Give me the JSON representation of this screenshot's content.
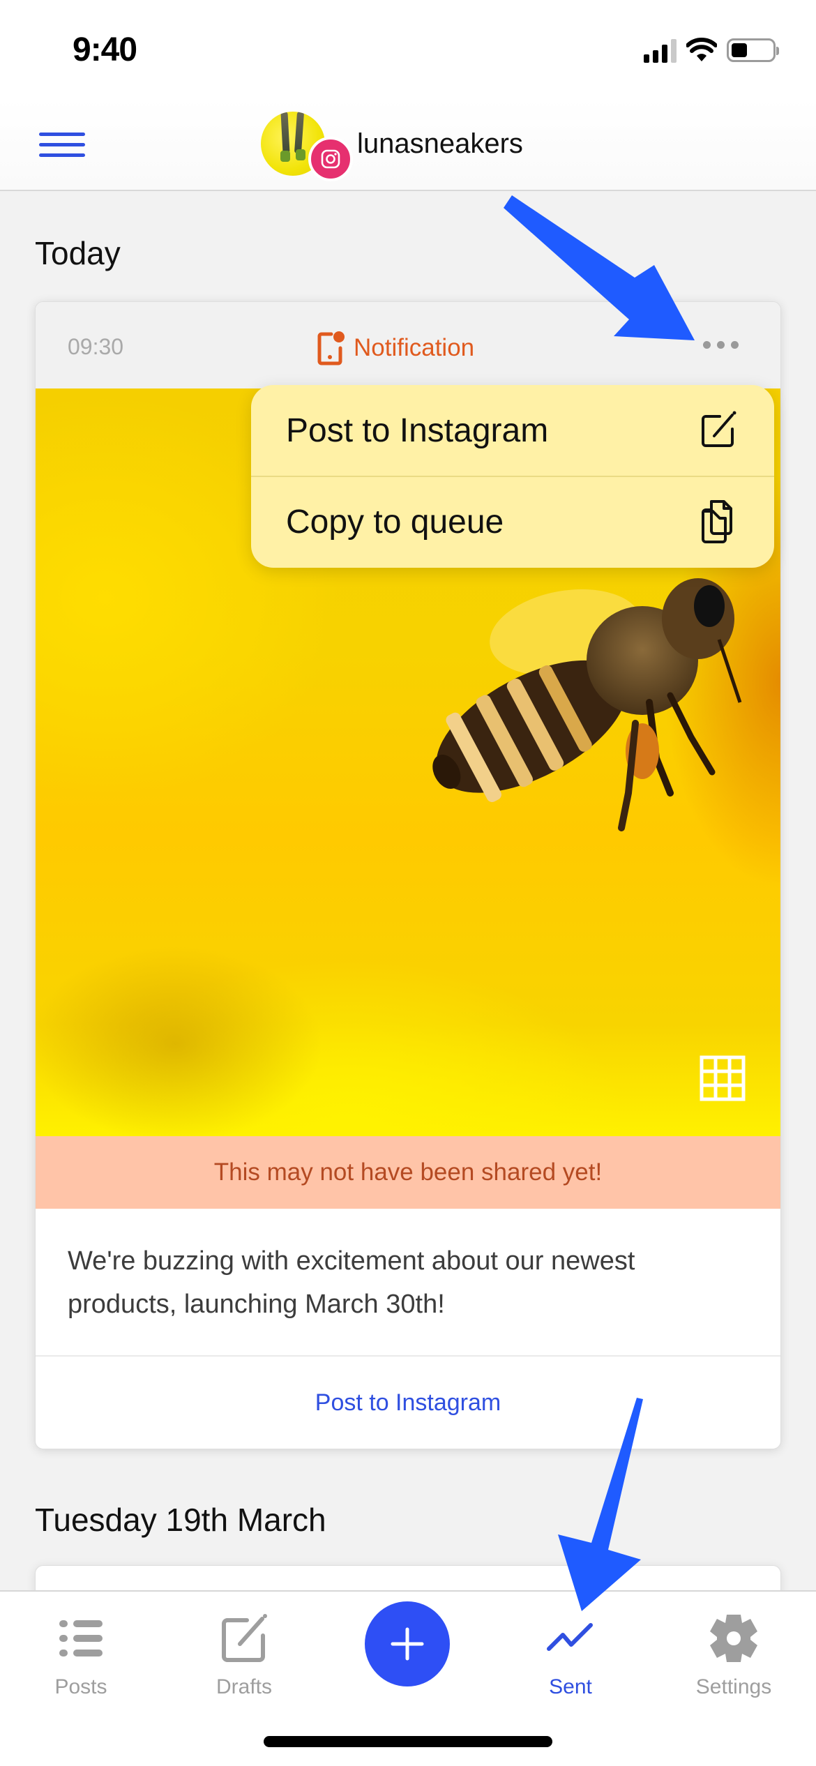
{
  "status_bar": {
    "time": "9:40",
    "icons": [
      "cellular-signal-icon",
      "wifi-icon",
      "battery-icon"
    ]
  },
  "header": {
    "menu_icon": "hamburger-menu-icon",
    "account_name": "lunasneakers",
    "account_platform": "instagram",
    "colors": {
      "accent": "#2f4fe0",
      "instagram_badge": "#e6306f"
    }
  },
  "sections": [
    {
      "title": "Today"
    },
    {
      "title": "Tuesday 19th March"
    }
  ],
  "post_card": {
    "time": "09:30",
    "type_label": "Notification",
    "type_icon": "notification-icon",
    "more_icon": "more-options-icon",
    "image_alt": "Bee flying over yellow flower",
    "gallery_icon": "grid-icon",
    "warning": "This may not have been shared yet!",
    "caption": "We're buzzing with excitement about our newest products, launching March 30th!",
    "action_label": "Post to Instagram",
    "colors": {
      "type": "#e05a1e",
      "warning_bg": "#ffc4a8",
      "warning_text": "#b44a22"
    }
  },
  "context_menu": {
    "items": [
      {
        "label": "Post to Instagram",
        "icon": "compose-icon"
      },
      {
        "label": "Copy to queue",
        "icon": "copy-icon"
      }
    ],
    "background": "#fff1a6"
  },
  "tab_bar": {
    "tabs": [
      {
        "label": "Posts",
        "icon": "list-icon",
        "active": false
      },
      {
        "label": "Drafts",
        "icon": "compose-icon",
        "active": false
      },
      {
        "label": "",
        "icon": "plus-icon",
        "active": false
      },
      {
        "label": "Sent",
        "icon": "chart-line-icon",
        "active": true
      },
      {
        "label": "Settings",
        "icon": "gear-icon",
        "active": false
      }
    ],
    "active_color": "#2f4fe0",
    "inactive_color": "#9e9e9e"
  },
  "annotations": [
    {
      "type": "arrow",
      "points_to": "more-options-button",
      "color": "#1f5bff"
    },
    {
      "type": "arrow",
      "points_to": "tab-sent",
      "color": "#1f5bff"
    }
  ]
}
